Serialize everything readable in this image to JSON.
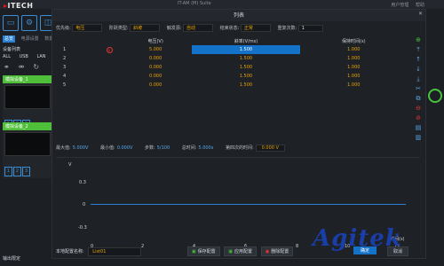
{
  "app": {
    "brand": "ITECH",
    "title": "IT-AM (M) Suite",
    "top_links": [
      "用户管理",
      "帮助"
    ]
  },
  "left": {
    "subnav": [
      "总览",
      "电源设置",
      "数据采集"
    ],
    "device_list_label": "设备列表",
    "conn_tabs": [
      "ALL",
      "USB",
      "LAN"
    ],
    "devices": [
      {
        "name": "模拟设备_1",
        "buttons": [
          "1",
          "2",
          "3"
        ]
      },
      {
        "name": "模拟设备_2",
        "buttons": [
          "1",
          "2",
          "3"
        ]
      }
    ],
    "bottom_text": "输出限定"
  },
  "dialog": {
    "title": "列表",
    "controls": {
      "output_label": "优先级:",
      "output_value": "电压",
      "step_type_label": "阶跃类型:",
      "step_type_value": "斜坡",
      "trigger_label": "触发源:",
      "trigger_value": "自动",
      "end_state_label": "结束状态:",
      "end_state_value": "正常",
      "repeat_label": "重复次数:",
      "repeat_value": "1"
    },
    "table": {
      "headers": [
        "",
        "",
        "电压(V)",
        "斜率(V/ms)",
        "保持时间(s)"
      ],
      "rows": [
        {
          "idx": "1",
          "voltage": "5.000",
          "slope": "1.500",
          "hold": "1.000"
        },
        {
          "idx": "2",
          "voltage": "0.000",
          "slope": "1.500",
          "hold": "1.000"
        },
        {
          "idx": "3",
          "voltage": "0.000",
          "slope": "1.500",
          "hold": "1.000"
        },
        {
          "idx": "4",
          "voltage": "0.000",
          "slope": "1.500",
          "hold": "1.000"
        },
        {
          "idx": "5",
          "voltage": "0.000",
          "slope": "1.500",
          "hold": "1.000"
        }
      ]
    },
    "stats": {
      "max_label": "最大值:",
      "max_value": "5.000V",
      "min_label": "最小值:",
      "min_value": "0.000V",
      "steps_label": "步数:",
      "steps_value": "5/100",
      "total_label": "总时间:",
      "total_value": "5.000s",
      "overall_label": "第四次的时间:",
      "overall_value": "0.000 V"
    },
    "plot": {
      "y_ticks": [
        "0.3",
        "0",
        "-0.3"
      ],
      "x_ticks": [
        "0",
        "2",
        "4",
        "6",
        "8",
        "10",
        "12"
      ],
      "unit_label": "V",
      "time_label": "时间(s)"
    },
    "footer": {
      "config_label": "本地配置名称:",
      "config_value": "List01",
      "save_label": "保存配置",
      "apply_label": "应用配置",
      "delete_label": "删除配置",
      "ok_label": "确定",
      "cancel_label": "取消"
    }
  },
  "watermark": "Agitek"
}
